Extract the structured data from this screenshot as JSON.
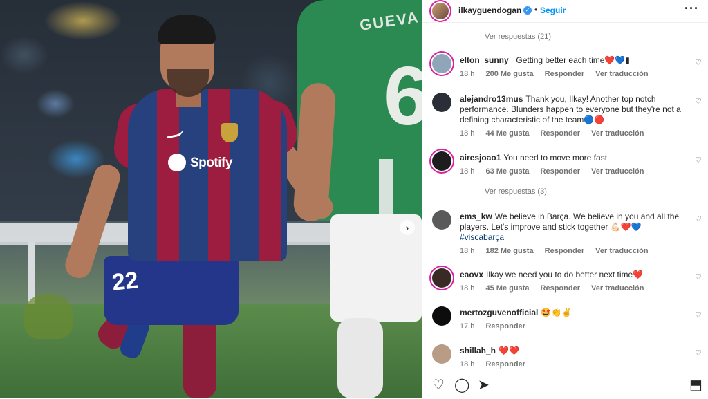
{
  "post": {
    "username": "ilkayguendogan",
    "verified_badge": "✓",
    "separator": "•",
    "follow_label": "Seguir",
    "more_label": "···",
    "next_arrow": "›",
    "photo": {
      "sponsor_text": "Spotify",
      "player_number": "22",
      "other_player_number": "6",
      "other_player_name": "GUEVA"
    }
  },
  "comments": [
    {
      "type": "replies",
      "label": "Ver respuestas (21)"
    },
    {
      "type": "comment",
      "user": "elton_sunny_",
      "text": "Getting better each time❤️💙▮",
      "time": "18 h",
      "likes": "200 Me gusta",
      "reply": "Responder",
      "translate": "Ver traducción",
      "avatar_color": "#8fa6b8"
    },
    {
      "type": "comment",
      "user": "alejandro13mus",
      "text": "Thank you, Ilkay! Another top notch performance. Blunders happen to everyone but they're not a defining characteristic of the team🔵🔴",
      "time": "18 h",
      "likes": "44 Me gusta",
      "reply": "Responder",
      "translate": "Ver traducción",
      "avatar_color": "#2a2e36"
    },
    {
      "type": "comment",
      "user": "airesjoao1",
      "text": "You need to move more fast",
      "time": "18 h",
      "likes": "63 Me gusta",
      "reply": "Responder",
      "translate": "Ver traducción",
      "avatar_color": "#1d1d1d"
    },
    {
      "type": "replies",
      "label": "Ver respuestas (3)"
    },
    {
      "type": "comment",
      "user": "ems_kw",
      "text": "We believe in Barça. We believe in you and all the players. Let's improve and stick together 💪🏻❤️💙",
      "hashtag": "#viscabarça",
      "time": "18 h",
      "likes": "182 Me gusta",
      "reply": "Responder",
      "translate": "Ver traducción",
      "avatar_color": "#5a5a5a"
    },
    {
      "type": "comment",
      "user": "eaovx",
      "text": "Ilkay we need you to do better next time❤️",
      "time": "18 h",
      "likes": "45 Me gusta",
      "reply": "Responder",
      "translate": "Ver traducción",
      "avatar_color": "#3a2a26"
    },
    {
      "type": "comment",
      "user": "mertozguvenofficial",
      "text": "🤩👏✌️",
      "time": "17 h",
      "reply": "Responder",
      "avatar_color": "#0d0d0d"
    },
    {
      "type": "comment",
      "user": "shillah_h",
      "text": "❤️❤️",
      "time": "18 h",
      "reply": "Responder",
      "avatar_color": "#b89c86"
    }
  ],
  "actions": {
    "like_icon": "♡",
    "comment_icon": "◯",
    "share_icon": "➤",
    "save_icon": "⬒"
  },
  "colors": {
    "follow": "#0095f6",
    "hashtag": "#00376b",
    "verified": "#3897f0"
  }
}
